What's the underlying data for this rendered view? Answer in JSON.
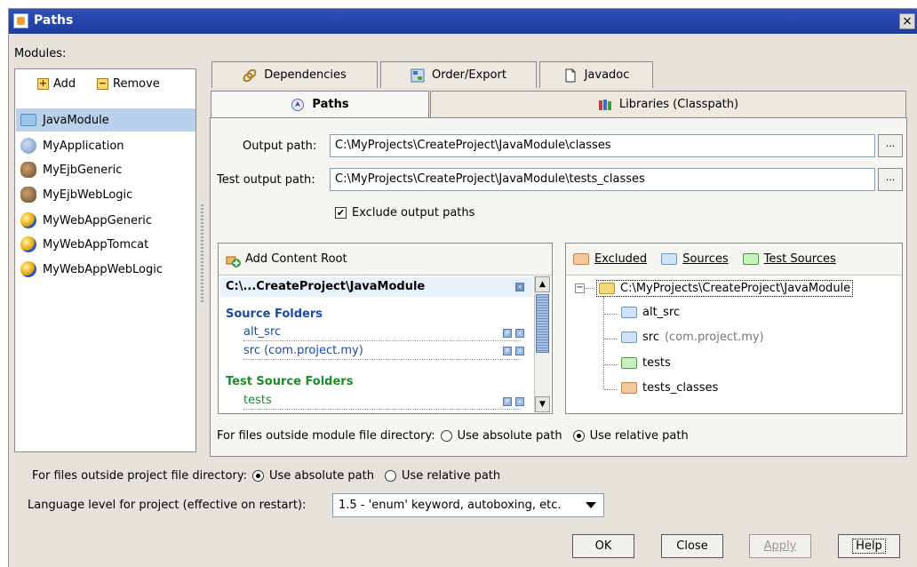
{
  "window": {
    "title": "Paths",
    "close": "×"
  },
  "modules": {
    "label": "Modules:",
    "add": "Add",
    "remove": "Remove",
    "items": [
      {
        "label": "JavaModule",
        "icon": "java-module-icon"
      },
      {
        "label": "MyApplication",
        "icon": "application-icon"
      },
      {
        "label": "MyEjbGeneric",
        "icon": "ejb-icon"
      },
      {
        "label": "MyEjbWebLogic",
        "icon": "ejb-icon"
      },
      {
        "label": "MyWebAppGeneric",
        "icon": "web-icon"
      },
      {
        "label": "MyWebAppTomcat",
        "icon": "web-icon"
      },
      {
        "label": "MyWebAppWebLogic",
        "icon": "web-icon"
      }
    ]
  },
  "tabs": {
    "dependencies": "Dependencies",
    "order_export": "Order/Export",
    "javadoc": "Javadoc",
    "paths": "Paths",
    "libraries": "Libraries (Classpath)"
  },
  "paths": {
    "output_label": "Output path:",
    "output_value": "C:\\MyProjects\\CreateProject\\JavaModule\\classes",
    "test_output_label": "Test output path:",
    "test_output_value": "C:\\MyProjects\\CreateProject\\JavaModule\\tests_classes",
    "browse": "...",
    "exclude_label": "Exclude output paths",
    "exclude_checked": "✔"
  },
  "content_roots": {
    "add_label": "Add Content Root",
    "root": "C:\\...CreateProject\\JavaModule",
    "source_title": "Source Folders",
    "sources": [
      "alt_src",
      "src (com.project.my)"
    ],
    "test_title": "Test Source Folders",
    "tests": [
      "tests"
    ]
  },
  "tree": {
    "legend_excluded": "Excluded",
    "legend_sources": "Sources",
    "legend_tests": "Test Sources",
    "root": "C:\\MyProjects\\CreateProject\\JavaModule",
    "toggle": "−",
    "children": [
      {
        "name": "alt_src",
        "suffix": ""
      },
      {
        "name": "src",
        "suffix": "(com.project.my)"
      },
      {
        "name": "tests",
        "suffix": ""
      },
      {
        "name": "tests_classes",
        "suffix": ""
      }
    ]
  },
  "module_outside": {
    "label": "For files outside module file directory:",
    "absolute": "Use absolute path",
    "relative": "Use relative path",
    "selected": "relative"
  },
  "project_outside": {
    "label": "For files outside project file directory:",
    "absolute": "Use absolute path",
    "relative": "Use relative path",
    "selected": "absolute"
  },
  "language": {
    "label": "Language level for project (effective on restart):",
    "value": "1.5 - 'enum' keyword, autoboxing, etc."
  },
  "buttons": {
    "ok": "OK",
    "close": "Close",
    "apply": "Apply",
    "help": "Help"
  }
}
